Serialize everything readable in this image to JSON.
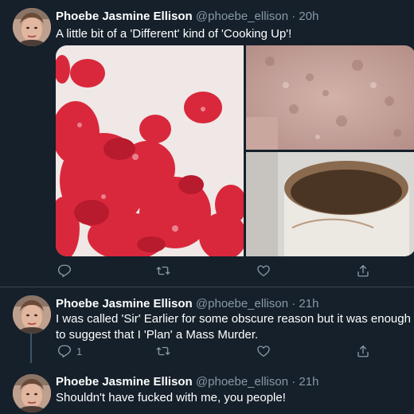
{
  "colors": {
    "background": "#15202b",
    "secondary_text": "#8899a6",
    "divider": "#38444d"
  },
  "tweets": [
    {
      "display_name": "Phoebe Jasmine Ellison",
      "handle": "@phoebe_ellison",
      "separator": "·",
      "time": "20h",
      "text": "A little bit of a 'Different' kind of 'Cooking Up'!",
      "media": [
        "red-crumbled-pieces-photo",
        "pink-powder-photo",
        "cardboard-tube-photo"
      ],
      "reply_count": "",
      "icons": [
        "reply-icon",
        "retweet-icon",
        "like-icon",
        "share-icon"
      ]
    },
    {
      "display_name": "Phoebe Jasmine Ellison",
      "handle": "@phoebe_ellison",
      "separator": "·",
      "time": "21h",
      "text": "I was called 'Sir' Earlier for some obscure reason but it was enough to suggest that I 'Plan' a Mass Murder.",
      "reply_count": "1",
      "icons": [
        "reply-icon",
        "retweet-icon",
        "like-icon",
        "share-icon"
      ]
    },
    {
      "display_name": "Phoebe Jasmine Ellison",
      "handle": "@phoebe_ellison",
      "separator": "·",
      "time": "21h",
      "text": "Shouldn't have fucked with me, you people!"
    }
  ]
}
